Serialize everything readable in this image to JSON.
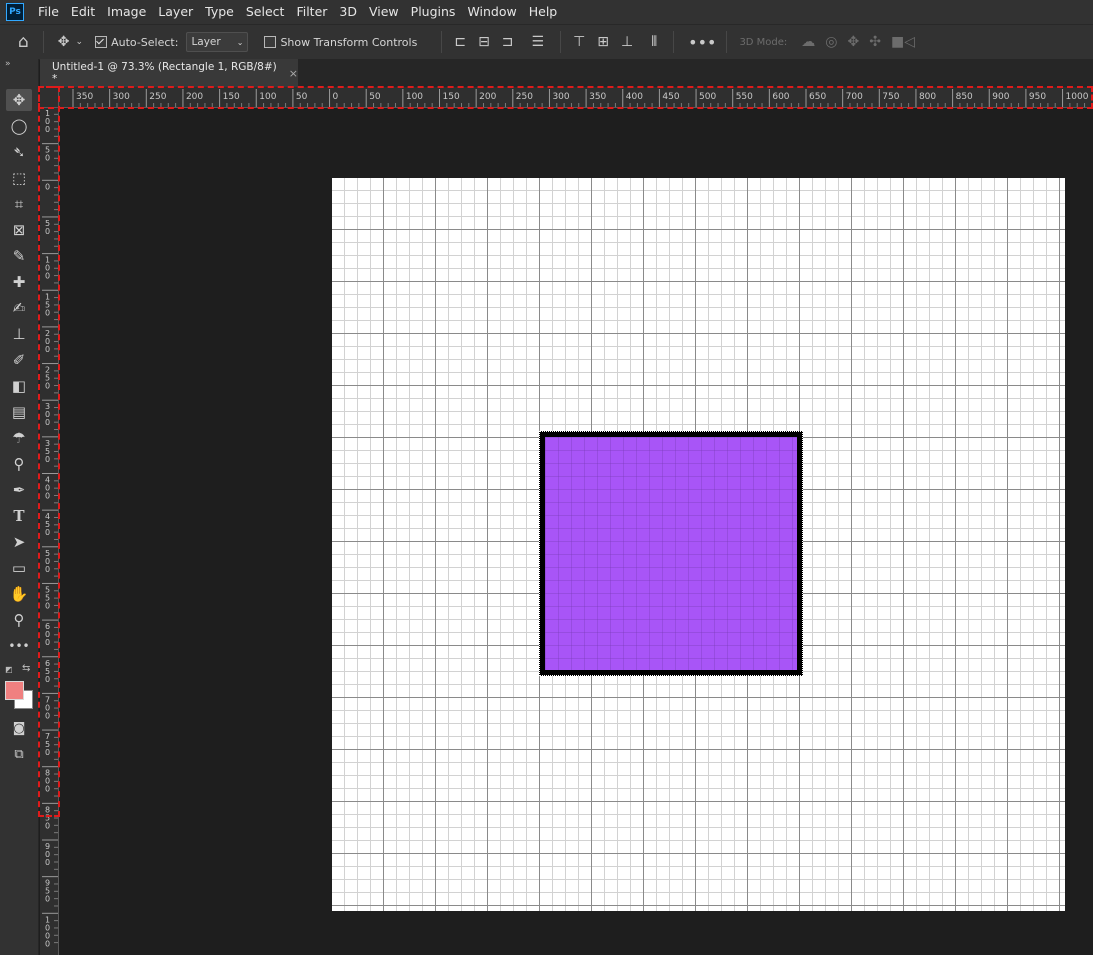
{
  "app": {
    "logo": "Ps"
  },
  "menu": [
    "File",
    "Edit",
    "Image",
    "Layer",
    "Type",
    "Select",
    "Filter",
    "3D",
    "View",
    "Plugins",
    "Window",
    "Help"
  ],
  "options_bar": {
    "auto_select_label": "Auto-Select:",
    "auto_select_checked": true,
    "auto_select_target": "Layer",
    "show_transform_label": "Show Transform Controls",
    "show_transform_checked": false,
    "mode_3d_label": "3D Mode:"
  },
  "document_tab": {
    "title": "Untitled-1 @ 73.3% (Rectangle 1, RGB/8#) *",
    "close": "×"
  },
  "rulers": {
    "horizontal_labels": [
      "350",
      "300",
      "250",
      "200",
      "150",
      "100",
      "50",
      "0",
      "50",
      "100",
      "150",
      "200",
      "250",
      "300",
      "350",
      "400",
      "450",
      "500",
      "550",
      "600",
      "650",
      "700",
      "750",
      "800",
      "850",
      "900",
      "950",
      "1000"
    ],
    "vertical_labels": [
      "100",
      "50",
      "0",
      "50",
      "100",
      "150",
      "200",
      "250",
      "300",
      "350",
      "400",
      "450",
      "500",
      "550",
      "600",
      "650",
      "700",
      "750",
      "800",
      "850",
      "900",
      "950",
      "1000"
    ]
  },
  "colors": {
    "foreground": "#f08080",
    "background": "#ffffff",
    "shape_fill": "#a855f7",
    "highlight": "#e01a1a"
  },
  "tools": [
    "move-tool",
    "marquee-tool",
    "lasso-tool",
    "object-selection-tool",
    "crop-tool",
    "frame-tool",
    "eyedropper-tool",
    "healing-brush-tool",
    "brush-tool",
    "clone-stamp-tool",
    "history-brush-tool",
    "eraser-tool",
    "gradient-tool",
    "blur-tool",
    "dodge-tool",
    "pen-tool",
    "type-tool",
    "path-selection-tool",
    "rectangle-tool",
    "hand-tool",
    "zoom-tool",
    "more-tools"
  ]
}
